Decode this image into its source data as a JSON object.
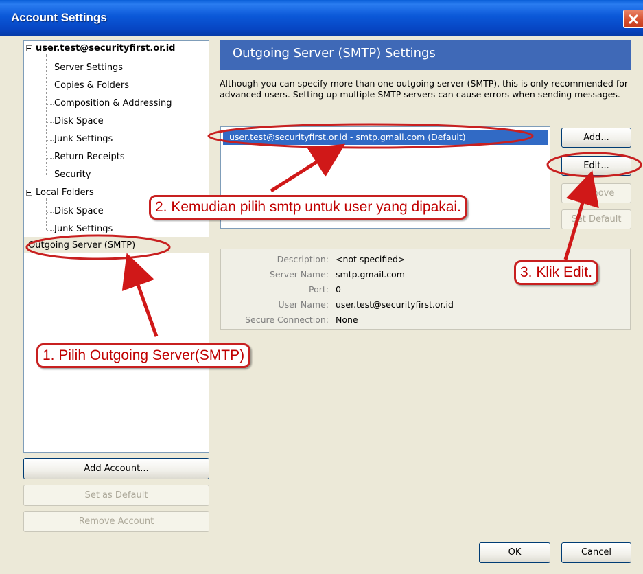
{
  "window": {
    "title": "Account Settings"
  },
  "tree": {
    "account": "user.test@securityfirst.or.id",
    "account_children": [
      "Server Settings",
      "Copies & Folders",
      "Composition & Addressing",
      "Disk Space",
      "Junk Settings",
      "Return Receipts",
      "Security"
    ],
    "local_folders": "Local Folders",
    "local_children": [
      "Disk Space",
      "Junk Settings"
    ],
    "outgoing": "Outgoing Server (SMTP)"
  },
  "left_buttons": {
    "add_account": "Add Account...",
    "set_default": "Set as Default",
    "remove_account": "Remove Account"
  },
  "panel": {
    "header": "Outgoing Server (SMTP) Settings",
    "description": "Although you can specify more than one outgoing server (SMTP), this is only recommended for advanced users. Setting up multiple SMTP servers can cause errors when sending messages.",
    "servers": [
      "user.test@securityfirst.or.id - smtp.gmail.com (Default)"
    ],
    "buttons": {
      "add": "Add...",
      "edit": "Edit...",
      "remove": "Remove",
      "set_default": "Set Default"
    },
    "details": {
      "description_label": "Description:",
      "description_value": "<not specified>",
      "server_name_label": "Server Name:",
      "server_name_value": "smtp.gmail.com",
      "port_label": "Port:",
      "port_value": "0",
      "user_name_label": "User Name:",
      "user_name_value": "user.test@securityfirst.or.id",
      "secure_label": "Secure Connection:",
      "secure_value": "None"
    }
  },
  "dialog_buttons": {
    "ok": "OK",
    "cancel": "Cancel"
  },
  "annotations": {
    "step1": "1. Pilih Outgoing Server(SMTP)",
    "step2": "2. Kemudian pilih smtp untuk user yang dipakai.",
    "step3": "3. Klik Edit."
  },
  "colors": {
    "annotation_red": "#d01818",
    "selection_blue": "#316ac5",
    "header_blue": "#3f69b7"
  },
  "icons": {
    "close": "close-icon"
  }
}
